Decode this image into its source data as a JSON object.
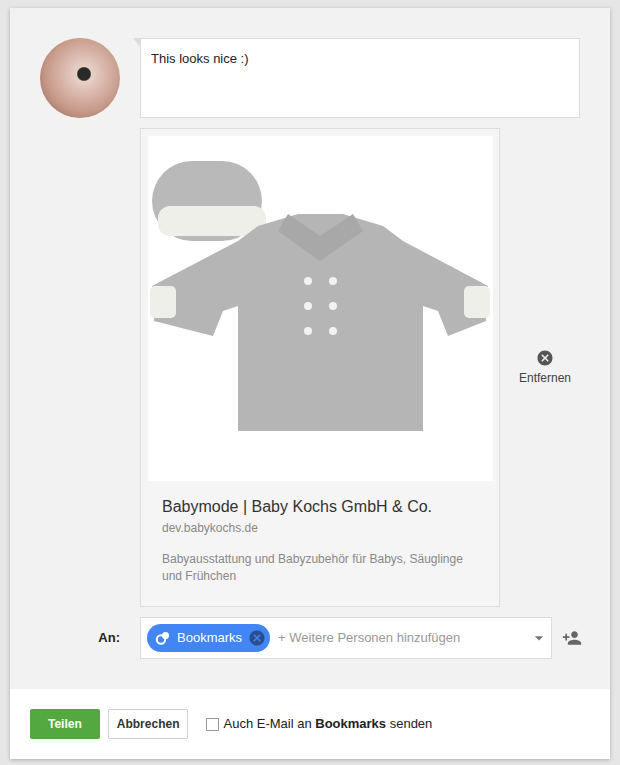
{
  "comment": {
    "text": "This looks nice :)"
  },
  "link_preview": {
    "title": "Babymode | Baby Kochs GmbH & Co.",
    "domain": "dev.babykochs.de",
    "description": "Babyausstattung und Babyzubehör für Babys, Säuglinge und Frühchen"
  },
  "remove": {
    "label": "Entfernen"
  },
  "recipients": {
    "label": "An:",
    "chips": [
      {
        "label": "Bookmarks"
      }
    ],
    "placeholder": "+ Weitere Personen hinzufügen"
  },
  "buttons": {
    "share": "Teilen",
    "cancel": "Abbrechen"
  },
  "email_option": {
    "prefix": "Auch E-Mail an ",
    "bold": "Bookmarks",
    "suffix": " senden",
    "checked": false
  }
}
